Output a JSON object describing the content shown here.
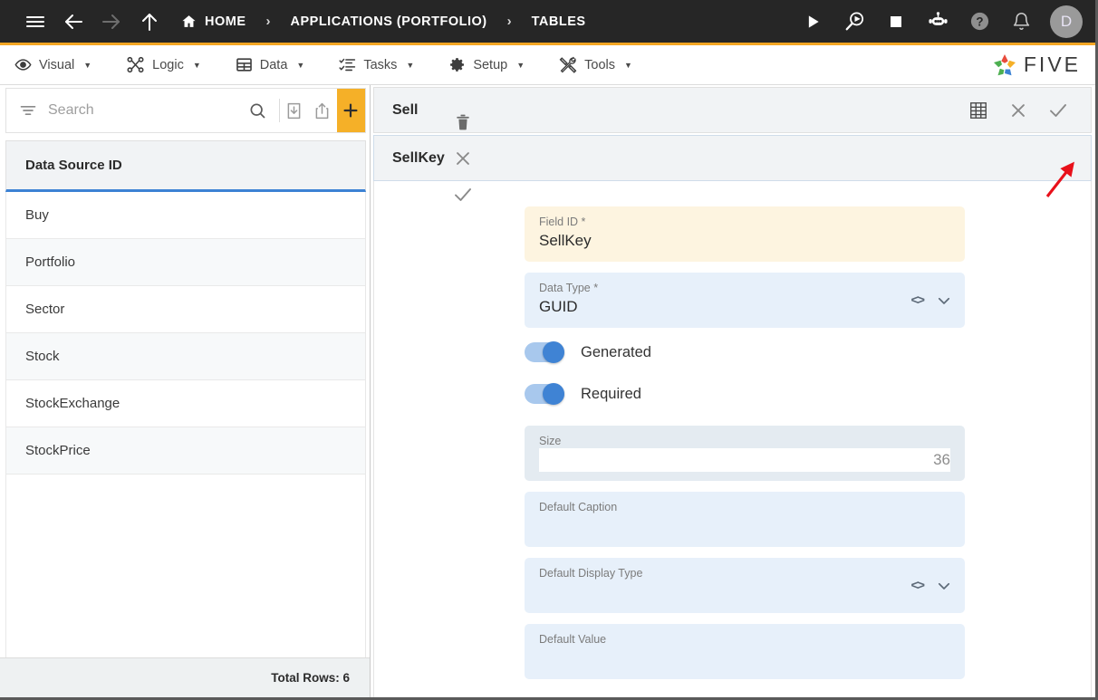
{
  "topbar": {
    "menu_icon": "hamburger-icon",
    "back_icon": "arrow-left-icon",
    "forward_icon": "arrow-right-icon",
    "up_icon": "arrow-up-icon",
    "breadcrumbs": [
      {
        "label": "HOME",
        "icon": "home-icon"
      },
      {
        "label": "APPLICATIONS (PORTFOLIO)",
        "icon": ""
      },
      {
        "label": "TABLES",
        "icon": ""
      }
    ],
    "separator": "›",
    "actions": [
      {
        "name": "run-icon",
        "title": "Run"
      },
      {
        "name": "debug-icon",
        "title": "Debug"
      },
      {
        "name": "stop-icon",
        "title": "Stop"
      },
      {
        "name": "chatbot-icon",
        "title": "Assistant"
      },
      {
        "name": "help-icon",
        "title": "Help"
      },
      {
        "name": "notifications-bell-icon",
        "title": "Notifications"
      }
    ],
    "avatar_initial": "D",
    "accent_color": "#f5a623",
    "background_color": "#262626"
  },
  "menubar": {
    "items": [
      {
        "label": "Visual",
        "icon": "eye-icon",
        "caret": "▼"
      },
      {
        "label": "Logic",
        "icon": "logic-nodes-icon",
        "caret": "▼"
      },
      {
        "label": "Data",
        "icon": "table-grid-icon",
        "caret": "▼"
      },
      {
        "label": "Tasks",
        "icon": "checklist-icon",
        "caret": "▼"
      },
      {
        "label": "Setup",
        "icon": "gear-icon",
        "caret": "▼"
      },
      {
        "label": "Tools",
        "icon": "tools-icon",
        "caret": "▼"
      }
    ],
    "brand": {
      "text": "FIVE",
      "icon": "five-pinwheel-logo"
    }
  },
  "sidebar": {
    "search": {
      "placeholder": "Search",
      "value": ""
    },
    "toolbar": [
      {
        "name": "filter-icon"
      },
      {
        "name": "search-icon"
      },
      {
        "name": "import-icon"
      },
      {
        "name": "export-icon"
      },
      {
        "name": "add-button",
        "label": "+"
      }
    ],
    "table": {
      "column_header": "Data Source ID",
      "rows": [
        {
          "label": "Buy"
        },
        {
          "label": "Portfolio"
        },
        {
          "label": "Sector"
        },
        {
          "label": "Stock"
        },
        {
          "label": "StockExchange"
        },
        {
          "label": "StockPrice"
        }
      ]
    },
    "footer": {
      "total_rows_label": "Total Rows: 6"
    }
  },
  "main": {
    "record_bar": {
      "title": "Sell",
      "actions": [
        {
          "name": "table-grid-icon"
        },
        {
          "name": "close-icon",
          "glyph": "✕"
        },
        {
          "name": "save-check-icon",
          "glyph": "✓"
        }
      ]
    },
    "field_bar": {
      "title": "SellKey",
      "actions": [
        {
          "name": "delete-trash-icon"
        },
        {
          "name": "close-icon",
          "glyph": "✕"
        },
        {
          "name": "save-check-icon",
          "glyph": "✓"
        }
      ]
    },
    "form": {
      "fields": [
        {
          "name": "field-id",
          "label": "Field ID *",
          "value": "SellKey",
          "style": "cream",
          "adornments": []
        },
        {
          "name": "data-type",
          "label": "Data Type *",
          "value": "GUID",
          "style": "blue",
          "adornments": [
            "code-icon",
            "chevron-down-icon"
          ]
        }
      ],
      "toggles": [
        {
          "name": "generated-toggle",
          "label": "Generated",
          "on": true
        },
        {
          "name": "required-toggle",
          "label": "Required",
          "on": true
        }
      ],
      "fields2": [
        {
          "name": "size",
          "label": "Size",
          "value": "36",
          "style": "muted",
          "align": "right",
          "adornments": []
        },
        {
          "name": "default-caption",
          "label": "Default Caption",
          "value": "",
          "style": "blue",
          "adornments": []
        },
        {
          "name": "default-display-type",
          "label": "Default Display Type",
          "value": "",
          "style": "blue",
          "adornments": [
            "code-icon",
            "chevron-down-icon"
          ]
        },
        {
          "name": "default-value",
          "label": "Default Value",
          "value": "",
          "style": "blue",
          "adornments": []
        }
      ]
    }
  },
  "annotation": {
    "arrow_color": "#e8101a",
    "points_to": "save-check-icon"
  }
}
